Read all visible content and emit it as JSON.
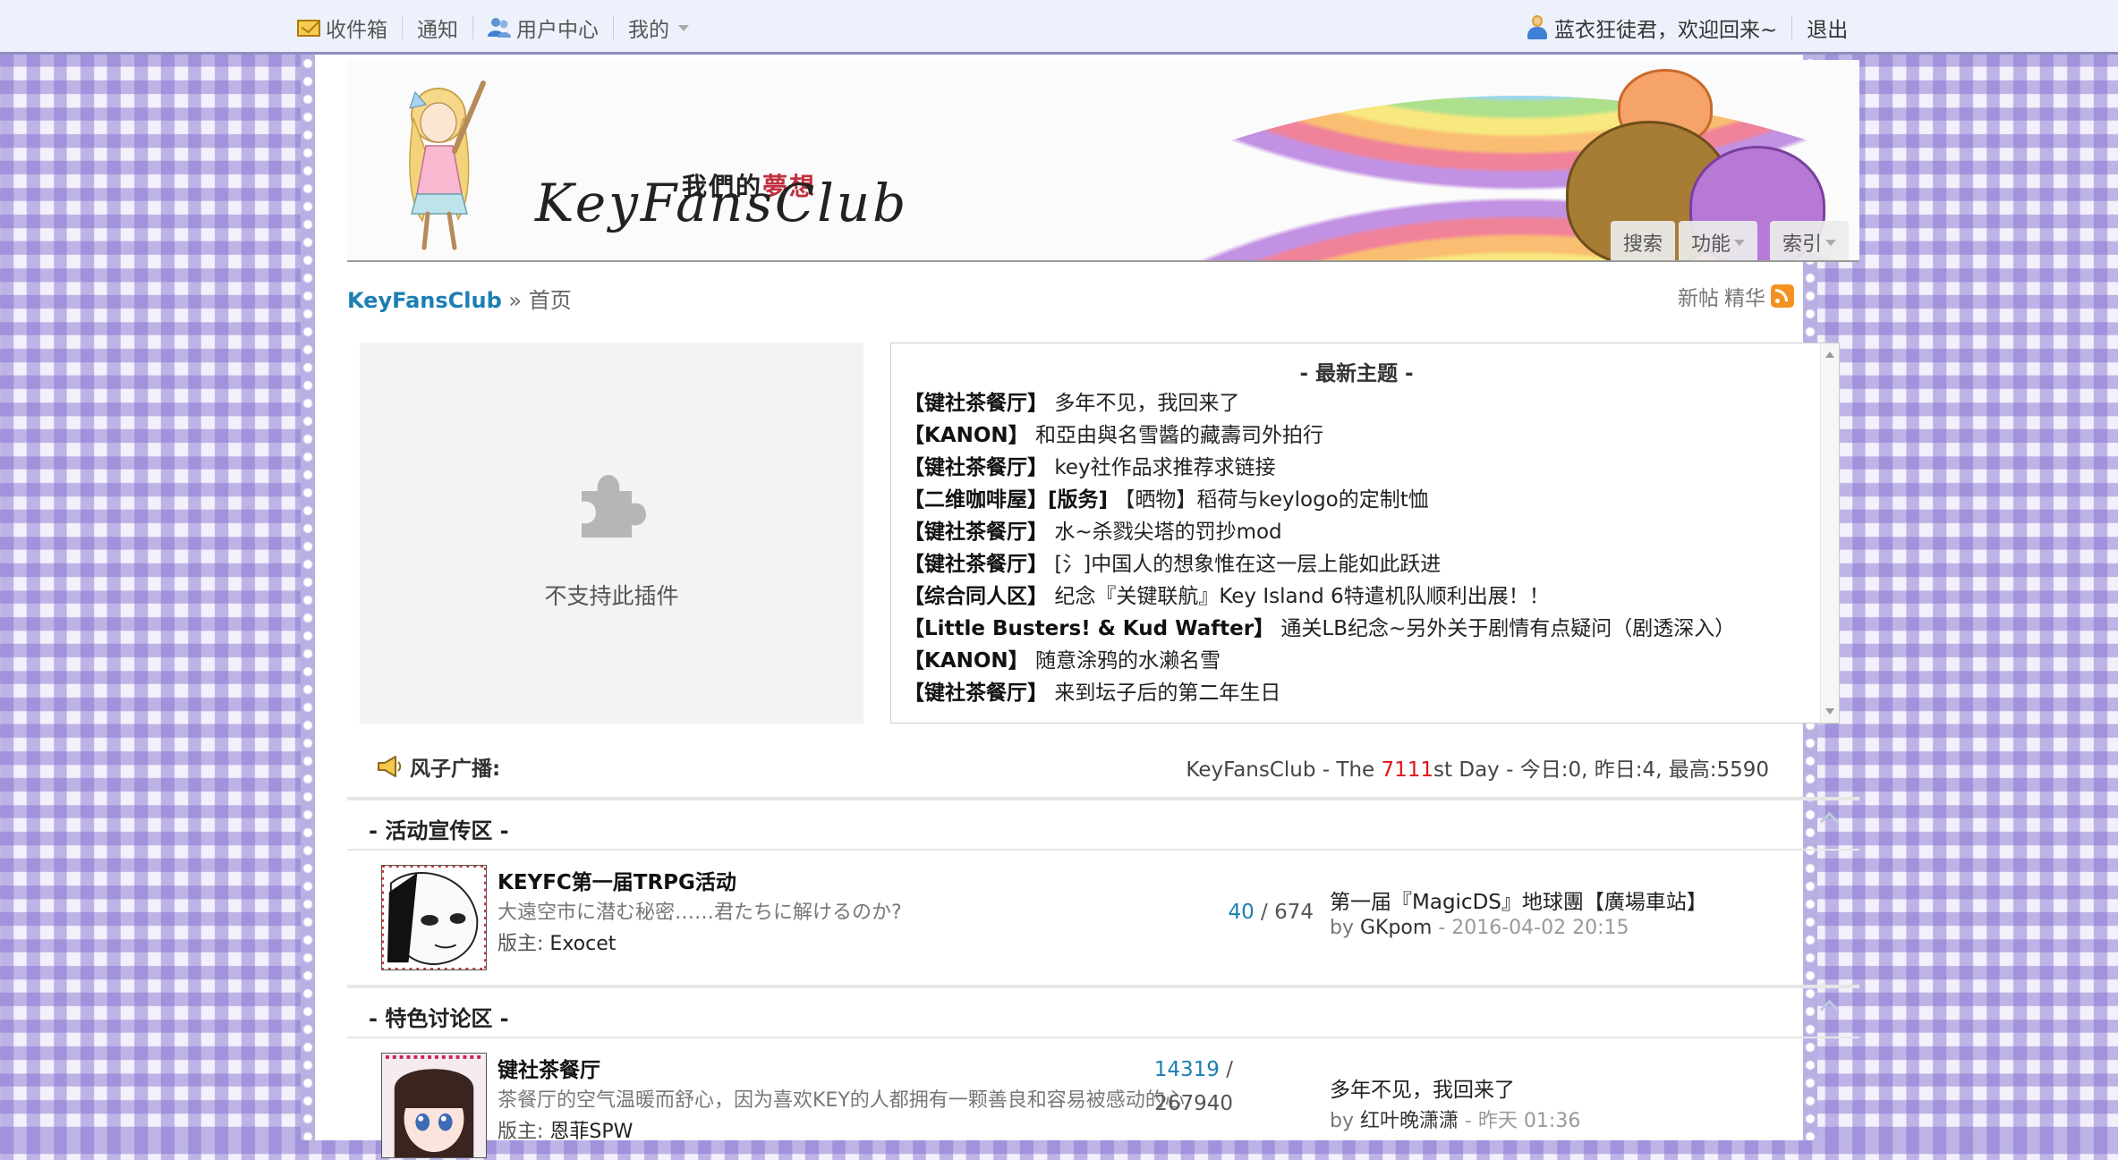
{
  "topbar": {
    "inbox": "收件箱",
    "notify": "通知",
    "user_center": "用户中心",
    "mine": "我的",
    "welcome": "蓝衣狂徒君，欢迎回来~",
    "logout": "退出"
  },
  "banner": {
    "logo_cn_main": "我們的",
    "logo_cn_accent": "夢想",
    "logo_en": "KeyFansClub",
    "tabs": [
      "搜索",
      "功能",
      "索引"
    ]
  },
  "breadcrumb": {
    "home": "KeyFansClub",
    "sep": "»",
    "current": "首页",
    "new_posts": "新帖",
    "digest": "精华"
  },
  "plugin": {
    "message": "不支持此插件"
  },
  "latest": {
    "title": "- 最新主题 -",
    "items": [
      {
        "board": "【键社茶餐厅】",
        "title": "多年不见，我回来了"
      },
      {
        "board": "【KANON】",
        "title": "和亞由與名雪醬的藏壽司外拍行"
      },
      {
        "board": "【键社茶餐厅】",
        "title": "key社作品求推荐求链接"
      },
      {
        "board": "【二维咖啡屋】[版务]",
        "title": "【晒物】稻荷与keylogo的定制t恤"
      },
      {
        "board": "【键社茶餐厅】",
        "title": "水~杀戮尖塔的罚抄mod"
      },
      {
        "board": "【键社茶餐厅】",
        "title": "[氵]中国人的想象惟在这一层上能如此跃进"
      },
      {
        "board": "【综合同人区】",
        "title": "纪念『关键联航』Key Island 6特遣机队顺利出展！！"
      },
      {
        "board": "【Little Busters! & Kud Wafter】",
        "title": "通关LB纪念~另外关于剧情有点疑问（剧透深入）"
      },
      {
        "board": "【KANON】",
        "title": "随意涂鸦的水濑名雪"
      },
      {
        "board": "【键社茶餐厅】",
        "title": "来到坛子后的第二年生日"
      }
    ]
  },
  "broadcast": {
    "label": "风子广播:"
  },
  "stats": {
    "prefix": "KeyFansClub - The ",
    "day": "7111",
    "suffix": "st Day - 今日:0, 昨日:4, 最高:5590"
  },
  "sections": [
    {
      "name": "- 活动宣传区 -",
      "forums": [
        {
          "name": "KEYFC第一届TRPG活动",
          "desc": "大遠空市に潜む秘密……君たちに解けるのか?",
          "mod_label": "版主:",
          "mod": "Exocet",
          "threads": "40",
          "slash": " / ",
          "posts": "674",
          "last_title": "第一届『MagicDS』地球團【廣場車站】",
          "last_by_label": "by ",
          "last_by": "GKpom",
          "last_time": " - 2016-04-02 20:15"
        }
      ]
    },
    {
      "name": "- 特色讨论区 -",
      "forums": [
        {
          "name": "键社茶餐厅",
          "desc": "茶餐厅的空气温暖而舒心，因为喜欢KEY的人都拥有一颗善良和容易被感动的心",
          "mod_label": "版主:",
          "mod": "恩菲SPW",
          "threads": "14319",
          "slash": " /",
          "posts": "267940",
          "last_title": "多年不见，我回来了",
          "last_by_label": "by ",
          "last_by": "红叶晚潇潇",
          "last_time": " - 昨天 01:36"
        }
      ]
    }
  ],
  "colors": {
    "link_blue": "#1b7fb4",
    "accent_red": "#e1141a",
    "lavender": "#8e8fbf"
  }
}
